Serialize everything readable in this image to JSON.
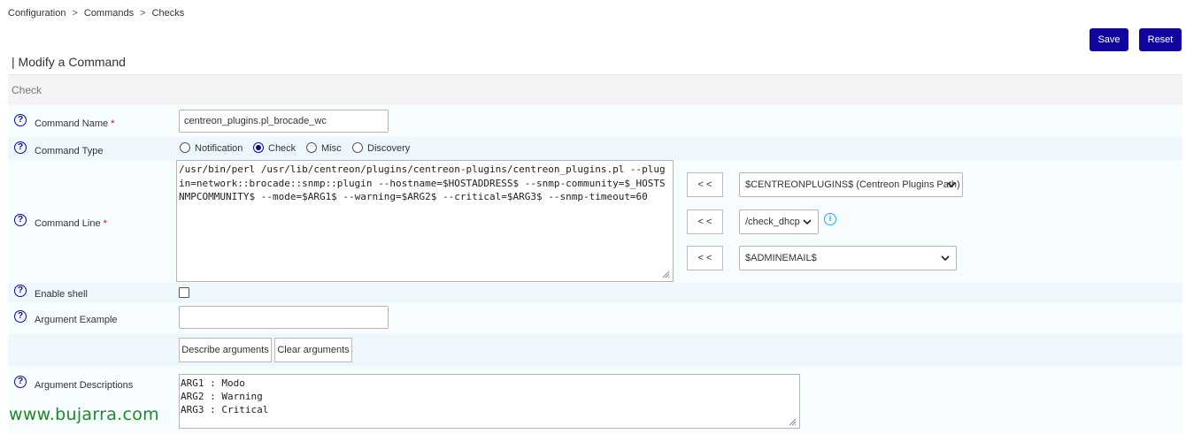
{
  "breadcrumb": {
    "items": [
      "Configuration",
      "Commands",
      "Checks"
    ],
    "separator": ">"
  },
  "toolbar": {
    "save_label": "Save",
    "reset_label": "Reset"
  },
  "page": {
    "title": "| Modify a Command",
    "section": "Check"
  },
  "colors": {
    "primary": "#10069f",
    "required": "#e00000",
    "watermark": "#1a8a2a",
    "info": "#29a8e0"
  },
  "form": {
    "help_glyph": "?",
    "required_mark": "*",
    "command_name": {
      "label": "Command Name",
      "value": "centreon_plugins.pl_brocade_wc"
    },
    "command_type": {
      "label": "Command Type",
      "options": [
        "Notification",
        "Check",
        "Misc",
        "Discovery"
      ],
      "selected": "Check"
    },
    "command_line": {
      "label": "Command Line",
      "value": "/usr/bin/perl /usr/lib/centreon/plugins/centreon-plugins/centreon_plugins.pl --plugin=network::brocade::snmp::plugin --hostname=$HOSTADDRESS$ --snmp-community=$_HOSTSNMPCOMMUNITY$ --mode=$ARG1$ --warning=$ARG2$ --critical=$ARG3$ --snmp-timeout=60",
      "insert_label": "< <",
      "macros": [
        {
          "selected": "$CENTREONPLUGINS$ (Centreon Plugins Path)"
        },
        {
          "selected": "/check_dhcp",
          "info_icon": "info-icon",
          "info_glyph": "i"
        },
        {
          "selected": "$ADMINEMAIL$"
        }
      ]
    },
    "enable_shell": {
      "label": "Enable shell",
      "checked": false
    },
    "argument_example": {
      "label": "Argument Example",
      "value": ""
    },
    "describe_label": "Describe arguments",
    "clear_label": "Clear arguments",
    "argument_descriptions": {
      "label": "Argument Descriptions",
      "value": "ARG1 : Modo\nARG2 : Warning\nARG3 : Critical"
    }
  },
  "watermark": "www.bujarra.com"
}
